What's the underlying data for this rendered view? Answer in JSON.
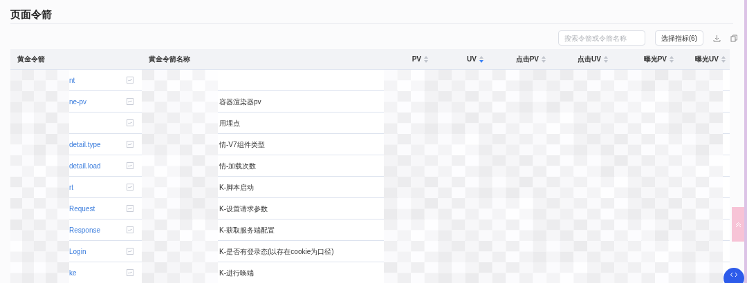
{
  "title": "页面令箭",
  "toolbar": {
    "search": {
      "placeholder": "搜索令箭或令箭名称"
    },
    "metrics_button": "选择指标(6)"
  },
  "table": {
    "columns": [
      {
        "label": "黄金令箭"
      },
      {
        "label": "黄金令箭名称"
      },
      {
        "label": "PV",
        "sorted_desc": false
      },
      {
        "label": "UV",
        "sorted_desc": true
      },
      {
        "label": "点击PV",
        "sorted_desc": false
      },
      {
        "label": "点击UV",
        "sorted_desc": false
      },
      {
        "label": "曝光PV",
        "sorted_desc": false
      },
      {
        "label": "曝光UV",
        "sorted_desc": false
      }
    ],
    "rows": [
      {
        "code": "nt"
      },
      {
        "code": "ne-pv",
        "name": "容器渲染器pv"
      },
      {
        "name": "用埋点"
      },
      {
        "code": "detail.type",
        "name": "情-V7组件类型"
      },
      {
        "code": "detail.load",
        "name": "情-加载次数"
      },
      {
        "code": "rt",
        "name": "K-脚本启动"
      },
      {
        "code": "Request",
        "name": "K-设置请求参数"
      },
      {
        "code": "Response",
        "name": "K-获取服务端配置"
      },
      {
        "code": "Login",
        "name": "K-是否有登录态(以存在cookie为口径)"
      },
      {
        "code": "ke",
        "name": "K-进行唤端"
      }
    ]
  }
}
